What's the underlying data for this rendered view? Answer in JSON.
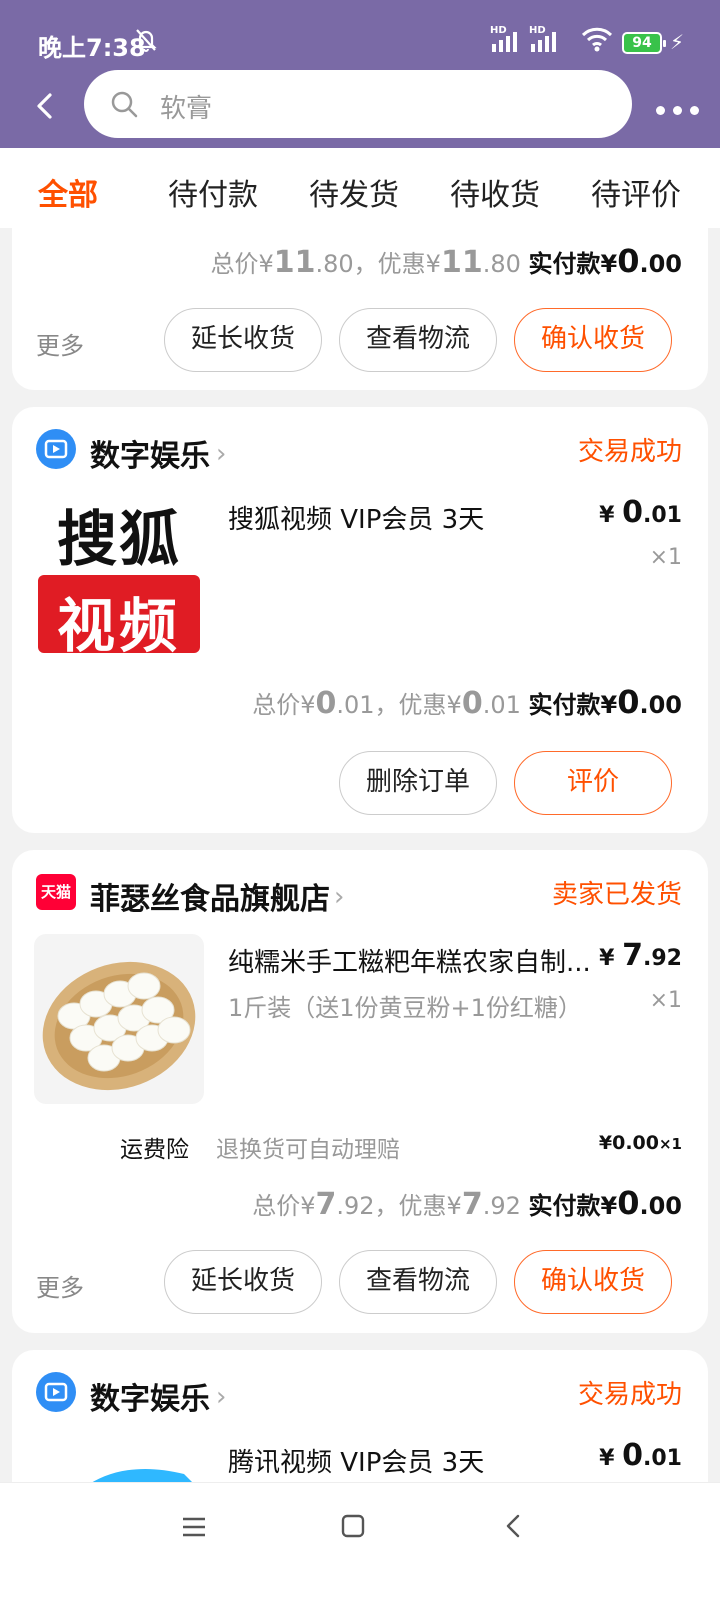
{
  "status_bar": {
    "time": "晚上7:38",
    "network1": "HD",
    "network2": "HD",
    "battery": "94"
  },
  "search": {
    "placeholder": "软膏"
  },
  "tabs": [
    {
      "label": "全部",
      "active": true
    },
    {
      "label": "待付款"
    },
    {
      "label": "待发货"
    },
    {
      "label": "待收货"
    },
    {
      "label": "待评价"
    }
  ],
  "orders": [
    {
      "total_prefix": "总价¥",
      "total_int": "11",
      "total_dec": ".80",
      "discount_prefix": "，优惠¥",
      "discount_int": "11",
      "discount_dec": ".80",
      "paid_prefix": "实付款¥",
      "paid_int": "0",
      "paid_dec": ".00",
      "more_label": "更多",
      "buttons": [
        "延长收货",
        "查看物流",
        "确认收货"
      ]
    },
    {
      "shop_name": "数字娱乐",
      "status": "交易成功",
      "logo_line1": "搜狐",
      "logo_line2": "视频",
      "item_title": "搜狐视频 VIP会员 3天",
      "price_symbol": "¥",
      "price_int": "0",
      "price_dec": ".01",
      "qty": "×1",
      "total_prefix": "总价¥",
      "total_int": "0",
      "total_dec": ".01",
      "discount_prefix": "，优惠¥",
      "discount_int": "0",
      "discount_dec": ".01",
      "paid_prefix": "实付款¥",
      "paid_int": "0",
      "paid_dec": ".00",
      "buttons": [
        "删除订单",
        "评价"
      ]
    },
    {
      "shop_badge": "天猫",
      "shop_name": "菲瑟丝食品旗舰店",
      "status": "卖家已发货",
      "item_title": "纯糯米手工糍粑年糕农家自制...",
      "item_sku": "1斤装（送1份黄豆粉+1份红糖）",
      "price_symbol": "¥",
      "price_int": "7",
      "price_dec": ".92",
      "qty": "×1",
      "insurance_label": "运费险",
      "insurance_desc": "退换货可自动理赔",
      "insurance_price": "¥0.00",
      "insurance_qty": "×1",
      "total_prefix": "总价¥",
      "total_int": "7",
      "total_dec": ".92",
      "discount_prefix": "，优惠¥",
      "discount_int": "7",
      "discount_dec": ".92",
      "paid_prefix": "实付款¥",
      "paid_int": "0",
      "paid_dec": ".00",
      "more_label": "更多",
      "buttons": [
        "延长收货",
        "查看物流",
        "确认收货"
      ]
    },
    {
      "shop_name": "数字娱乐",
      "status": "交易成功",
      "item_title": "腾讯视频 VIP会员 3天",
      "price_symbol": "¥",
      "price_int": "0",
      "price_dec": ".01"
    }
  ],
  "colors": {
    "header": "#7a6aa6",
    "accent": "#ff5000",
    "digital_icon": "#2f8ef5",
    "tmall": "#ff0036"
  },
  "icons": [
    "back-arrow-icon",
    "search-icon",
    "more-dots-icon",
    "tv-icon",
    "chevron-right-icon",
    "tmall-icon",
    "menu-icon",
    "home-icon",
    "nav-back-icon"
  ]
}
